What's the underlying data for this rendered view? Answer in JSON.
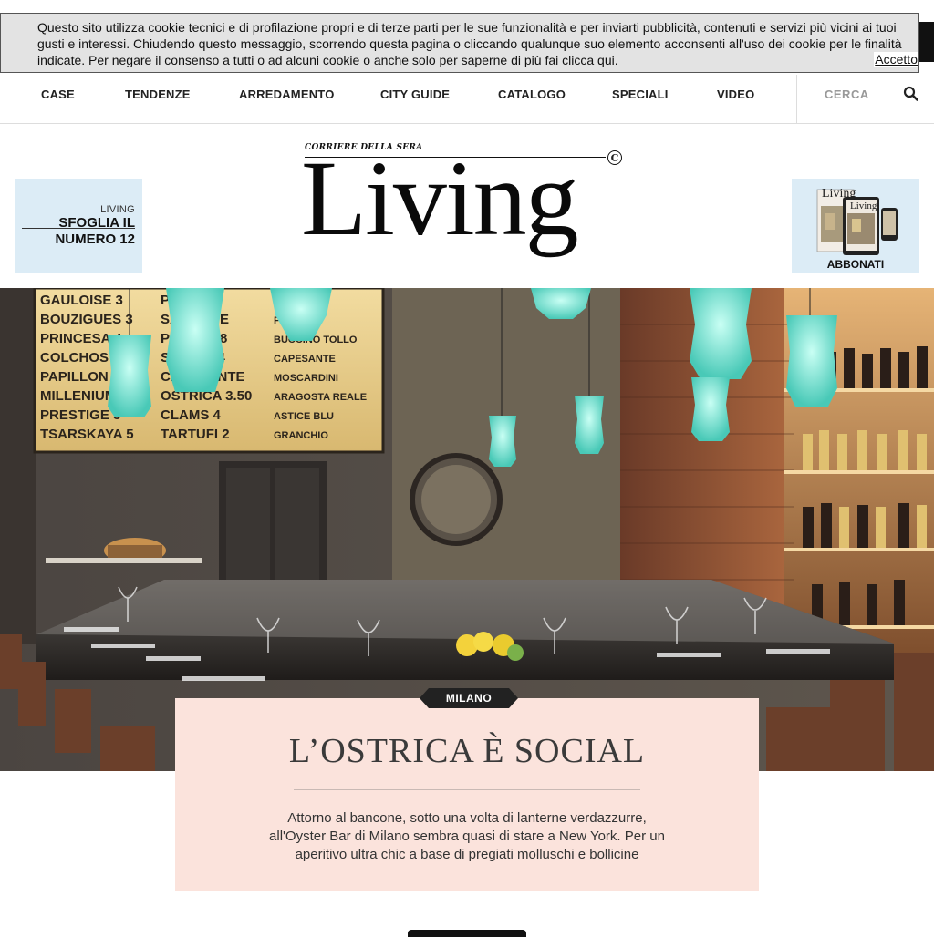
{
  "cookie": {
    "text": "Questo sito utilizza cookie tecnici e di profilazione propri e di terze parti per le sue funzionalità e per inviarti pubblicità, contenuti e servizi più vicini ai tuoi gusti e interessi. Chiudendo questo messaggio, scorrendo questa pagina o cliccando qualunque suo elemento acconsenti all'uso dei cookie per le finalità indicate. Per negare il consenso a tutti o ad alcuni cookie o anche solo per saperne di più fai clicca qui.",
    "accept_label": "Accetto"
  },
  "nav": {
    "items": [
      "CASE",
      "TENDENZE",
      "ARREDAMENTO",
      "CITY GUIDE",
      "CATALOGO",
      "SPECIALI",
      "VIDEO"
    ],
    "search_label": "CERCA",
    "search_icon": "magnifier-icon"
  },
  "header": {
    "logo_top": "CORRIERE DELLA SERA",
    "logo_main": "Living",
    "logo_badge": "C",
    "promo_left": {
      "small": "LIVING",
      "line1": "SFOGLIA IL",
      "line2": "NUMERO 12"
    },
    "promo_right": {
      "label": "ABBONATI",
      "mag_title": "Living"
    }
  },
  "article": {
    "tag": "MILANO",
    "title": "L’OSTRICA È SOCIAL",
    "summary": "Attorno al bancone, sotto una volta di lanterne verdazzurre, all'Oyster Bar di Milano sembra quasi di stare a New York. Per un aperitivo ultra chic a base di pregiati molluschi e bollicine",
    "hero_menu_lines": [
      "GAULOISE 3",
      "BOUZIGUES 3",
      "PRINCESA 4",
      "COLCHOS 4",
      "PAPILLON 2",
      "MILLENIUM 4",
      "PRESTIGE 5",
      "TSARSKAYA 5"
    ],
    "hero_menu_lines_right": [
      "PESCE",
      "SALMONE",
      "POLPO 18",
      "SCAMPI 4",
      "CAPESANTE",
      "OSTRICA 3.50",
      "CLAMS 4",
      "TARTUFI 2"
    ],
    "hero_menu_lines_far": [
      "OSTRICA",
      "POLPO",
      "BUCCINO TOLLO",
      "CAPESANTE",
      "MOSCARDINI",
      "ARAGOSTA REALE",
      "ASTICE BLU",
      "GRANCHIO"
    ]
  },
  "colors": {
    "accent_card": "#fbe3dc",
    "tag_bg": "#222222",
    "promo_bg": "#dcecf6",
    "lantern": "#7fe6d6"
  }
}
